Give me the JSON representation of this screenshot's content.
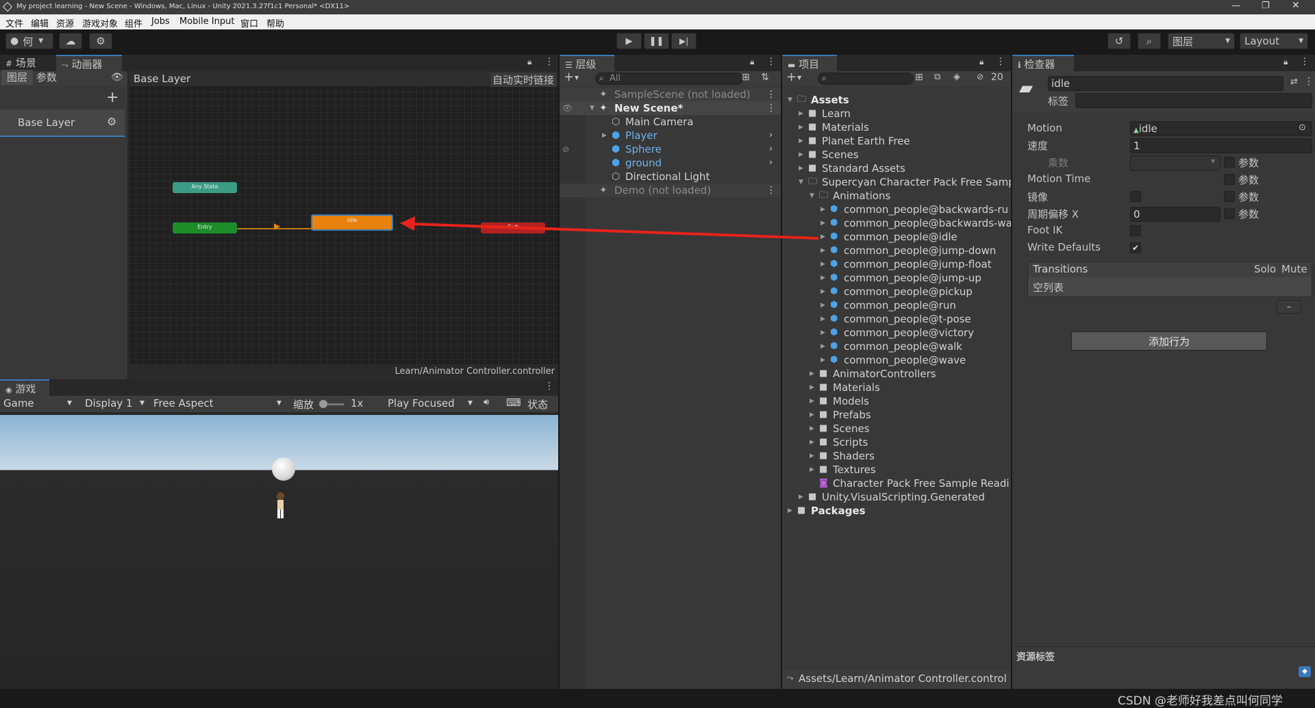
{
  "window": {
    "title": "My project learning - New Scene - Windows, Mac, Linux - Unity 2021.3.27f1c1 Personal* <DX11>"
  },
  "menu": [
    "文件",
    "编辑",
    "资源",
    "游戏对象",
    "组件",
    "Jobs",
    "Mobile Input",
    "窗口",
    "帮助"
  ],
  "toolbar": {
    "account": "何",
    "layers": "图层",
    "layout": "Layout"
  },
  "animator": {
    "tabs": {
      "scene": "场景",
      "animator": "动画器"
    },
    "subtabs": {
      "layers": "图层",
      "params": "参数"
    },
    "breadcrumb": "Base Layer",
    "live_link": "自动实时链接",
    "layer_name": "Base Layer",
    "nodes": {
      "any_state": "Any State",
      "entry": "Entry",
      "idle": "idle",
      "exit": "Exit"
    },
    "footer": "Learn/Animator Controller.controller"
  },
  "game": {
    "tab": "游戏",
    "display_mode": "Game",
    "display": "Display 1",
    "aspect": "Free Aspect",
    "scale_label": "缩放",
    "scale_value": "1x",
    "play_mode": "Play Focused",
    "stats": "状态"
  },
  "hierarchy": {
    "tab": "层级",
    "search_placeholder": "All",
    "items": [
      {
        "label": "SampleScene (not loaded)",
        "type": "scene",
        "indent": 0,
        "dim": true
      },
      {
        "label": "New Scene*",
        "type": "scene",
        "indent": 0,
        "bold": true
      },
      {
        "label": "Main Camera",
        "type": "go",
        "indent": 1
      },
      {
        "label": "Player",
        "type": "prefab",
        "indent": 1,
        "arrow": true
      },
      {
        "label": "Sphere",
        "type": "prefab",
        "indent": 1
      },
      {
        "label": "ground",
        "type": "prefab",
        "indent": 1
      },
      {
        "label": "Directional Light",
        "type": "go",
        "indent": 1
      },
      {
        "label": "Demo (not loaded)",
        "type": "scene",
        "indent": 0,
        "dim": true
      }
    ]
  },
  "project": {
    "tab": "项目",
    "hidden_count": "20",
    "footer": "Assets/Learn/Animator Controller.control",
    "tree": [
      {
        "label": "Assets",
        "indent": 0,
        "type": "folder",
        "bold": true,
        "open": true
      },
      {
        "label": "Learn",
        "indent": 1,
        "type": "folder"
      },
      {
        "label": "Materials",
        "indent": 1,
        "type": "folder"
      },
      {
        "label": "Planet Earth Free",
        "indent": 1,
        "type": "folder"
      },
      {
        "label": "Scenes",
        "indent": 1,
        "type": "folder"
      },
      {
        "label": "Standard Assets",
        "indent": 1,
        "type": "folder"
      },
      {
        "label": "Supercyan Character Pack Free Samp",
        "indent": 1,
        "type": "folder",
        "open": true
      },
      {
        "label": "Animations",
        "indent": 2,
        "type": "folder",
        "open": true
      },
      {
        "label": "common_people@backwards-ru",
        "indent": 3,
        "type": "model"
      },
      {
        "label": "common_people@backwards-wa",
        "indent": 3,
        "type": "model"
      },
      {
        "label": "common_people@idle",
        "indent": 3,
        "type": "model"
      },
      {
        "label": "common_people@jump-down",
        "indent": 3,
        "type": "model"
      },
      {
        "label": "common_people@jump-float",
        "indent": 3,
        "type": "model"
      },
      {
        "label": "common_people@jump-up",
        "indent": 3,
        "type": "model"
      },
      {
        "label": "common_people@pickup",
        "indent": 3,
        "type": "model"
      },
      {
        "label": "common_people@run",
        "indent": 3,
        "type": "model"
      },
      {
        "label": "common_people@t-pose",
        "indent": 3,
        "type": "model"
      },
      {
        "label": "common_people@victory",
        "indent": 3,
        "type": "model"
      },
      {
        "label": "common_people@walk",
        "indent": 3,
        "type": "model"
      },
      {
        "label": "common_people@wave",
        "indent": 3,
        "type": "model"
      },
      {
        "label": "AnimatorControllers",
        "indent": 2,
        "type": "folder"
      },
      {
        "label": "Materials",
        "indent": 2,
        "type": "folder"
      },
      {
        "label": "Models",
        "indent": 2,
        "type": "folder"
      },
      {
        "label": "Prefabs",
        "indent": 2,
        "type": "folder"
      },
      {
        "label": "Scenes",
        "indent": 2,
        "type": "folder"
      },
      {
        "label": "Scripts",
        "indent": 2,
        "type": "folder"
      },
      {
        "label": "Shaders",
        "indent": 2,
        "type": "folder"
      },
      {
        "label": "Textures",
        "indent": 2,
        "type": "folder"
      },
      {
        "label": "Character Pack Free Sample Readi",
        "indent": 2,
        "type": "pdf"
      },
      {
        "label": "Unity.VisualScripting.Generated",
        "indent": 1,
        "type": "folder"
      },
      {
        "label": "Packages",
        "indent": 0,
        "type": "folder",
        "bold": true
      }
    ]
  },
  "inspector": {
    "tab": "检查器",
    "name": "idle",
    "tag_label": "标签",
    "motion_label": "Motion",
    "motion_value": "idle",
    "speed_label": "速度",
    "speed_value": "1",
    "multiplier_label": "乘数",
    "param_label": "参数",
    "motion_time_label": "Motion Time",
    "mirror_label": "镜像",
    "cycle_offset_label": "周期偏移 X",
    "cycle_offset_value": "0",
    "foot_ik_label": "Foot IK",
    "write_defaults_label": "Write Defaults",
    "write_defaults_checked": true,
    "transitions_label": "Transitions",
    "solo_label": "Solo",
    "mute_label": "Mute",
    "empty_list": "空列表",
    "minus": "–",
    "add_behaviour": "添加行为",
    "asset_labels": "资源标签"
  },
  "watermark": "CSDN @老师好我差点叫何同学",
  "colors": {
    "accent": "#3a79bb",
    "idle_node": "#e8820c",
    "entry_node": "#1d8e2a",
    "any_state": "#3c9b84",
    "exit_node": "#b32121",
    "arrow": "#e8231a"
  }
}
